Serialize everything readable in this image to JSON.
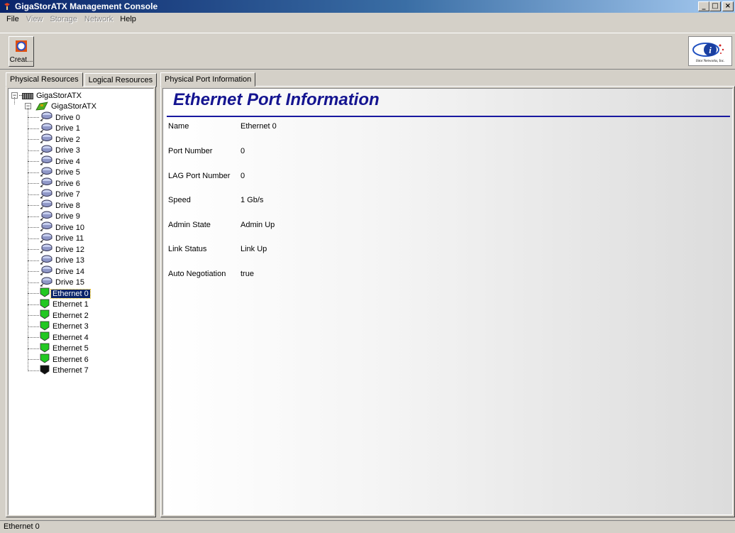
{
  "window": {
    "title": "GigaStorATX Management Console",
    "controls": [
      "_",
      "□",
      "×"
    ]
  },
  "menu": [
    {
      "label": "File",
      "enabled": true
    },
    {
      "label": "View",
      "enabled": false
    },
    {
      "label": "Storage",
      "enabled": false
    },
    {
      "label": "Network",
      "enabled": false
    },
    {
      "label": "Help",
      "enabled": true
    }
  ],
  "toolbar": {
    "create_label": "Creat...",
    "logo_text": "iStor Networks, Inc."
  },
  "left_tabs": [
    "Physical Resources",
    "Logical Resources"
  ],
  "tree": {
    "root": "GigaStorATX",
    "child": "GigaStorATX",
    "drives": [
      "Drive 0",
      "Drive 1",
      "Drive 2",
      "Drive 3",
      "Drive 4",
      "Drive 5",
      "Drive 6",
      "Drive 7",
      "Drive 8",
      "Drive 9",
      "Drive 10",
      "Drive 11",
      "Drive 12",
      "Drive 13",
      "Drive 14",
      "Drive 15"
    ],
    "ethernet": [
      "Ethernet 0",
      "Ethernet 1",
      "Ethernet 2",
      "Ethernet 3",
      "Ethernet 4",
      "Ethernet 5",
      "Ethernet 6",
      "Ethernet 7"
    ],
    "selected": "Ethernet 0"
  },
  "right_tab": "Physical Port Information",
  "content": {
    "heading": "Ethernet Port Information",
    "fields": [
      {
        "label": "Name",
        "value": "Ethernet 0"
      },
      {
        "label": "Port Number",
        "value": "0"
      },
      {
        "label": "LAG Port Number",
        "value": "0"
      },
      {
        "label": "Speed",
        "value": "1 Gb/s"
      },
      {
        "label": "Admin State",
        "value": "Admin Up"
      },
      {
        "label": "Link Status",
        "value": "Link Up"
      },
      {
        "label": "Auto Negotiation",
        "value": "true"
      }
    ]
  },
  "status": "Ethernet 0",
  "colors": {
    "title_bar": "#0a246a",
    "heading": "#141490",
    "port_up": "#22c822",
    "port_down": "#101010",
    "selection": "#0a246a"
  }
}
